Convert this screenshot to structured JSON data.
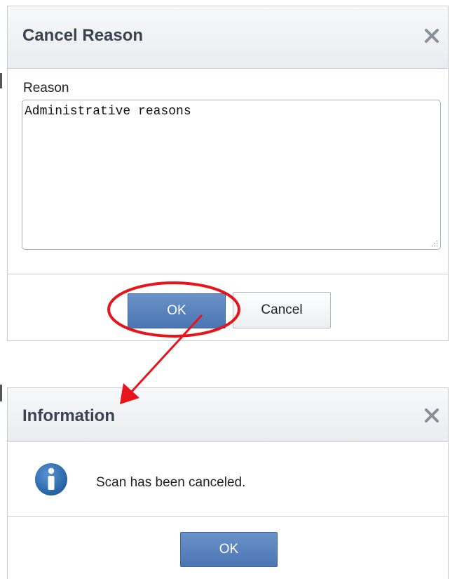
{
  "cancel_dialog": {
    "title": "Cancel Reason",
    "close_icon": "close-icon",
    "reason_label": "Reason",
    "reason_value": "Administrative reasons",
    "ok_label": "OK",
    "cancel_label": "Cancel"
  },
  "info_dialog": {
    "title": "Information",
    "close_icon": "close-icon",
    "icon": "info-icon",
    "message": "Scan has been canceled.",
    "ok_label": "OK"
  },
  "colors": {
    "primary_button": "#4b76b3",
    "annotation": "#e8141b",
    "info_icon": "#2e6fb3"
  }
}
